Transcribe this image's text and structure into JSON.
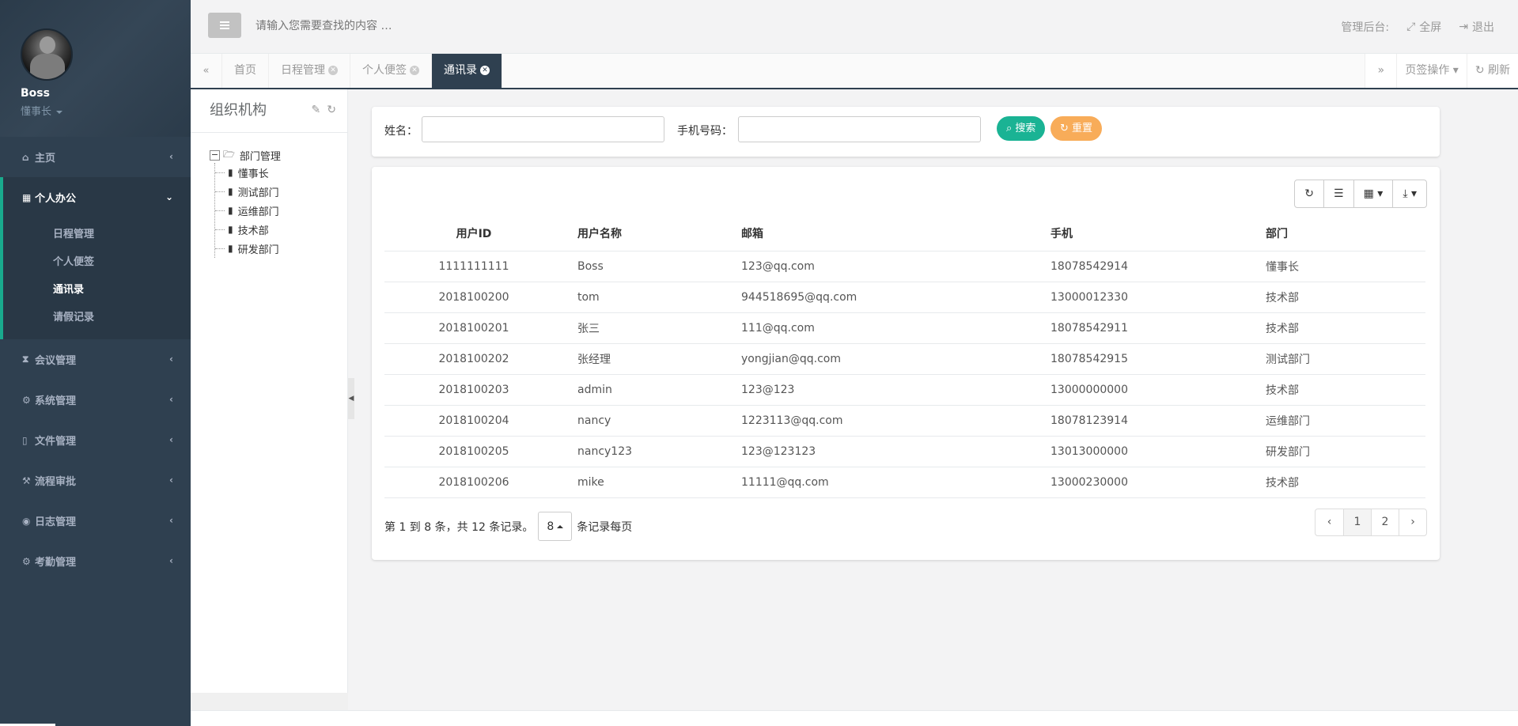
{
  "user": {
    "name": "Boss",
    "role": "懂事长"
  },
  "sidebar": {
    "items": [
      {
        "label": "主页",
        "icon": "home-icon"
      },
      {
        "label": "个人办公",
        "icon": "calendar-icon"
      },
      {
        "label": "会议管理",
        "icon": "hourglass-icon"
      },
      {
        "label": "系统管理",
        "icon": "gear-icon"
      },
      {
        "label": "文件管理",
        "icon": "file-icon"
      },
      {
        "label": "流程审批",
        "icon": "gavel-icon"
      },
      {
        "label": "日志管理",
        "icon": "eye-icon"
      },
      {
        "label": "考勤管理",
        "icon": "cogs-icon"
      }
    ],
    "sub_items": [
      "日程管理",
      "个人便签",
      "通讯录",
      "请假记录"
    ]
  },
  "top": {
    "search_placeholder": "请输入您需要查找的内容 …",
    "admin_label": "管理后台:",
    "fullscreen_label": "全屏",
    "logout_label": "退出"
  },
  "tabs": {
    "items": [
      "首页",
      "日程管理",
      "个人便签",
      "通讯录"
    ],
    "ops_label": "页签操作",
    "refresh_label": "刷新"
  },
  "org": {
    "title": "组织机构",
    "root": "部门管理",
    "children": [
      "懂事长",
      "测试部门",
      "运维部门",
      "技术部",
      "研发部门"
    ]
  },
  "search": {
    "name_label": "姓名：",
    "phone_label": "手机号码：",
    "search_btn": "搜索",
    "reset_btn": "重置"
  },
  "table": {
    "columns": [
      "用户ID",
      "用户名称",
      "邮箱",
      "手机",
      "部门"
    ],
    "rows": [
      [
        "1111111111",
        "Boss",
        "123@qq.com",
        "18078542914",
        "懂事长"
      ],
      [
        "2018100200",
        "tom",
        "944518695@qq.com",
        "13000012330",
        "技术部"
      ],
      [
        "2018100201",
        "张三",
        "111@qq.com",
        "18078542911",
        "技术部"
      ],
      [
        "2018100202",
        "张经理",
        "yongjian@qq.com",
        "18078542915",
        "测试部门"
      ],
      [
        "2018100203",
        "admin",
        "123@123",
        "13000000000",
        "技术部"
      ],
      [
        "2018100204",
        "nancy",
        "1223113@qq.com",
        "18078123914",
        "运维部门"
      ],
      [
        "2018100205",
        "nancy123",
        "123@123123",
        "13013000000",
        "研发部门"
      ],
      [
        "2018100206",
        "mike",
        "11111@qq.com",
        "13000230000",
        "技术部"
      ]
    ]
  },
  "pager": {
    "summary": "第 1 到 8 条，共 12 条记录。",
    "page_size": "8",
    "per_page_label": "条记录每页",
    "prev": "‹",
    "pages": [
      "1",
      "2"
    ],
    "next": "›"
  },
  "colors": {
    "sidebar": "#2f4050",
    "accent": "#19aa8d",
    "search_btn": "#1ab394",
    "reset_btn": "#f8ac59"
  }
}
